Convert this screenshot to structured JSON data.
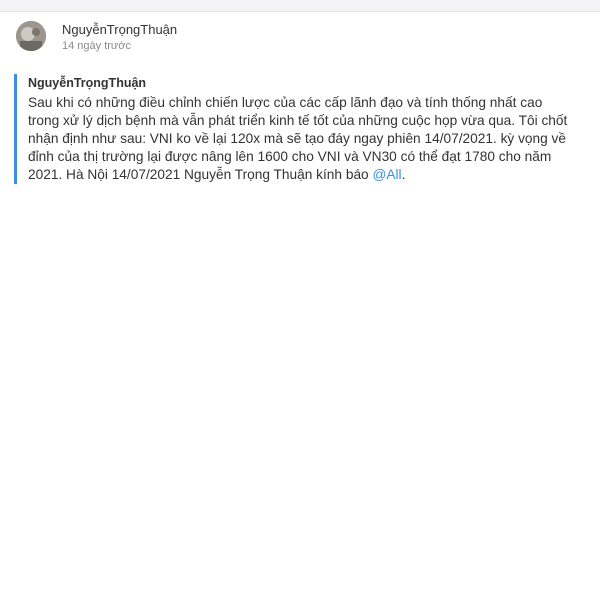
{
  "post": {
    "author": "NguyễnTrọngThuận",
    "time": "14 ngày trước",
    "avatar_icon": "user-avatar"
  },
  "quote": {
    "author": "NguyễnTrọngThuận",
    "text": "Sau khi có những điều chỉnh chiến lược của các cấp lãnh đạo và tính thống nhất cao trong xử lý dịch bệnh mà vẫn phát triển kinh tế tốt của những cuộc họp vừa qua. Tôi chốt nhận định như sau: VNI ko về lại 120x mà sẽ tạo đáy ngay phiên 14/07/2021. kỳ vọng về đỉnh của thị trường lại được nâng lên 1600 cho VNI và VN30 có thể đạt 1780 cho năm 2021. Hà Nội 14/07/2021 Nguyễn Trọng Thuận kính báo ",
    "mention": "@All",
    "trailing": "."
  },
  "colors": {
    "accent": "#3b8fe0",
    "text": "#333333",
    "muted": "#8a8a8a"
  }
}
